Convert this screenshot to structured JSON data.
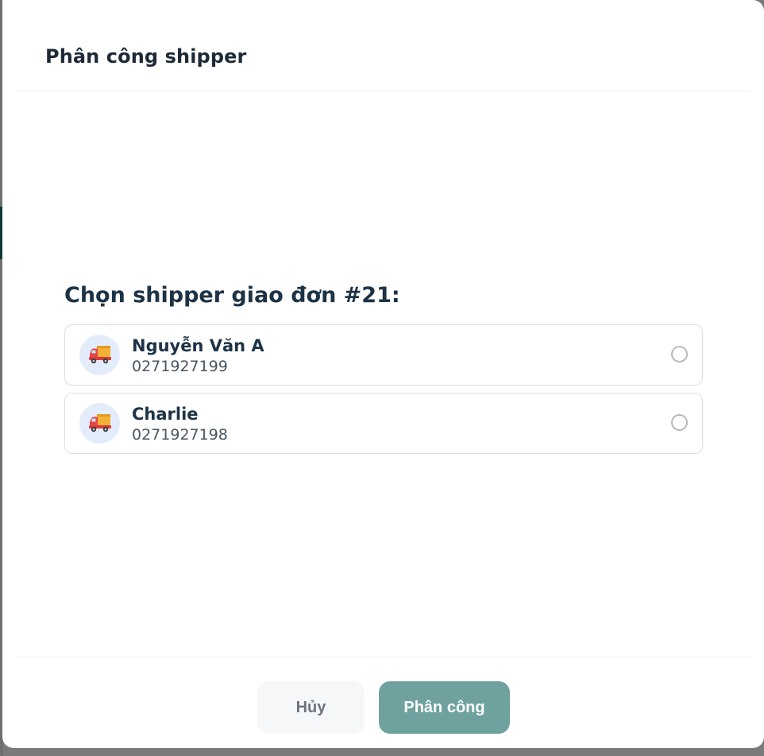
{
  "modal": {
    "title": "Phân công shipper"
  },
  "content": {
    "section_title": "Chọn shipper giao đơn #21:",
    "shippers": [
      {
        "name": "Nguyễn Văn A",
        "phone": "0271927199",
        "icon": "delivery-truck-icon",
        "selected": false
      },
      {
        "name": "Charlie",
        "phone": "0271927198",
        "icon": "delivery-truck-icon",
        "selected": false
      }
    ]
  },
  "footer": {
    "cancel_label": "Hủy",
    "assign_label": "Phân công"
  },
  "colors": {
    "primary": "#6fa29f",
    "heading": "#1e3345",
    "avatar_bg": "#e3ecfa"
  }
}
